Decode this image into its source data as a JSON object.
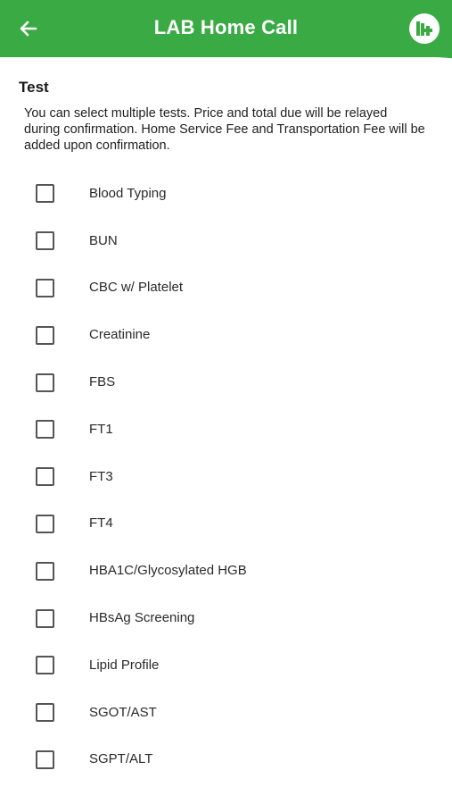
{
  "appbar": {
    "title": "LAB Home Call",
    "back_icon": "arrow-left-icon",
    "logo_icon": "clinic-logo-icon",
    "color": "#3aaa45"
  },
  "section": {
    "title": "Test",
    "note": "You can select multiple tests. Price and total due will be relayed during confirmation. Home Service Fee and Transportation Fee will be added upon confirmation."
  },
  "tests": [
    {
      "label": "Blood Typing",
      "checked": false
    },
    {
      "label": "BUN",
      "checked": false
    },
    {
      "label": "CBC w/ Platelet",
      "checked": false
    },
    {
      "label": "Creatinine",
      "checked": false
    },
    {
      "label": "FBS",
      "checked": false
    },
    {
      "label": "FT1",
      "checked": false
    },
    {
      "label": "FT3",
      "checked": false
    },
    {
      "label": "FT4",
      "checked": false
    },
    {
      "label": "HBA1C/Glycosylated HGB",
      "checked": false
    },
    {
      "label": "HBsAg Screening",
      "checked": false
    },
    {
      "label": "Lipid Profile",
      "checked": false
    },
    {
      "label": "SGOT/AST",
      "checked": false
    },
    {
      "label": "SGPT/ALT",
      "checked": false
    }
  ]
}
